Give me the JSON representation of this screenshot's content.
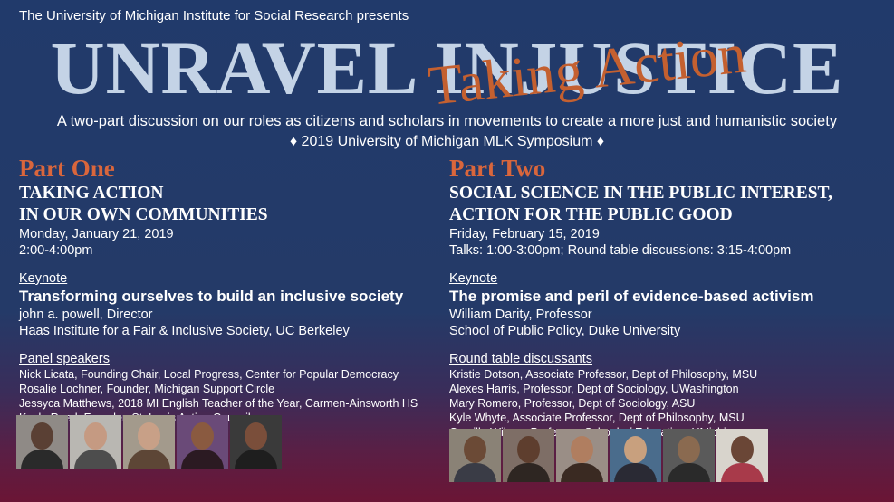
{
  "header": {
    "presents": "The University of Michigan Institute for Social Research presents",
    "title": "UNRAVEL INJUSTICE",
    "subtitle": "Taking Action",
    "tagline": "A two-part discussion on our roles as citizens and scholars in movements to create a more just and humanistic society",
    "symposium": "♦ 2019 University of Michigan MLK Symposium ♦"
  },
  "part_one": {
    "heading": "Part One",
    "title_line1": "Taking Action",
    "title_line2": "in Our Own Communities",
    "date": "Monday, January 21, 2019",
    "time": "2:00-4:00pm",
    "keynote_label": "Keynote",
    "keynote_title": "Transforming ourselves to build an inclusive society",
    "keynote_speaker": "john a. powell, Director",
    "keynote_affiliation": "Haas Institute for a Fair & Inclusive Society, UC Berkeley",
    "panel_label": "Panel speakers",
    "panel": [
      "Nick Licata, Founding Chair, Local Progress, Center for Popular Democracy",
      "Rosalie Lochner, Founder, Michigan Support Circle",
      "Jessyca Matthews, 2018 MI English Teacher of the Year, Carmen-Ainsworth HS",
      "Kayla Reed, Founder, St. Louis Action Council"
    ]
  },
  "part_two": {
    "heading": "Part Two",
    "title_line1": "Social Science in the Public Interest,",
    "title_line2": "Action for the Public Good",
    "date": "Friday, February 15, 2019",
    "time": "Talks: 1:00-3:00pm; Round table discussions: 3:15-4:00pm",
    "keynote_label": "Keynote",
    "keynote_title": "The promise and peril of evidence-based activism",
    "keynote_speaker": "William Darity, Professor",
    "keynote_affiliation": "School of Public Policy, Duke University",
    "roundtable_label": "Round table discussants",
    "roundtable": [
      "Kristie Dotson, Associate Professor, Dept of Philosophy, MSU",
      "Alexes Harris, Professor, Dept of Sociology, UWashington",
      "Mary Romero, Professor, Dept of Sociology, ASU",
      "Kyle Whyte, Associate Professor, Dept of Philosophy, MSU",
      "Camille Wilson, Professor, School of Education, UMichigan"
    ]
  },
  "colors": {
    "title": "#c4d3e6",
    "accent": "#c46030",
    "background_top": "#213a6b",
    "background_bottom": "#6b1535"
  }
}
